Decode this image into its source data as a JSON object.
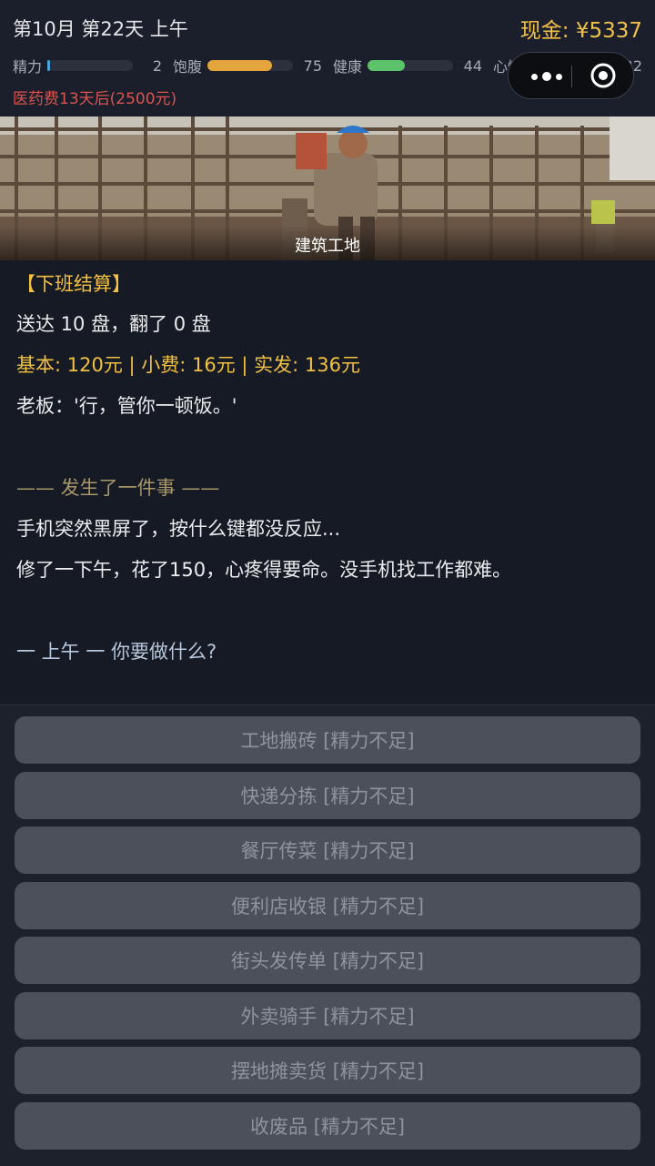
{
  "header": {
    "date": "第10月 第22天 上午",
    "cash": "现金: ¥5337",
    "warning": "医药费13天后(2500元)",
    "stats": [
      {
        "label": "精力",
        "value": "2",
        "level": 0.02,
        "color": "#4aa3df"
      },
      {
        "label": "饱腹",
        "value": "75",
        "level": 0.75,
        "color": "#e4a53c"
      },
      {
        "label": "健康",
        "value": "44",
        "level": 0.44,
        "color": "#5cc36b"
      },
      {
        "label": "心情",
        "value": "32",
        "level": 0.32,
        "color": "#8a5b9e"
      }
    ]
  },
  "capsule": {
    "more_icon": "more-dots-icon",
    "close_icon": "target-circle-icon"
  },
  "hero": {
    "caption": "建筑工地"
  },
  "log": {
    "settlement_title": "【下班结算】",
    "delivered": "送达 10 盘，翻了 0 盘",
    "pay": "基本: 120元 | 小费: 16元 | 实发: 136元",
    "boss": "老板：'行，管你一顿饭。'",
    "event_title": "—— 发生了一件事 ——",
    "event_line1": "手机突然黑屏了，按什么键都没反应...",
    "event_line2": "修了一下午，花了150，心疼得要命。没手机找工作都难。",
    "prompt": "一 上午 一  你要做什么?"
  },
  "actions": [
    "工地搬砖 [精力不足]",
    "快递分拣 [精力不足]",
    "餐厅传菜 [精力不足]",
    "便利店收银 [精力不足]",
    "街头发传单 [精力不足]",
    "外卖骑手 [精力不足]",
    "摆地摊卖货 [精力不足]",
    "收废品 [精力不足]"
  ]
}
